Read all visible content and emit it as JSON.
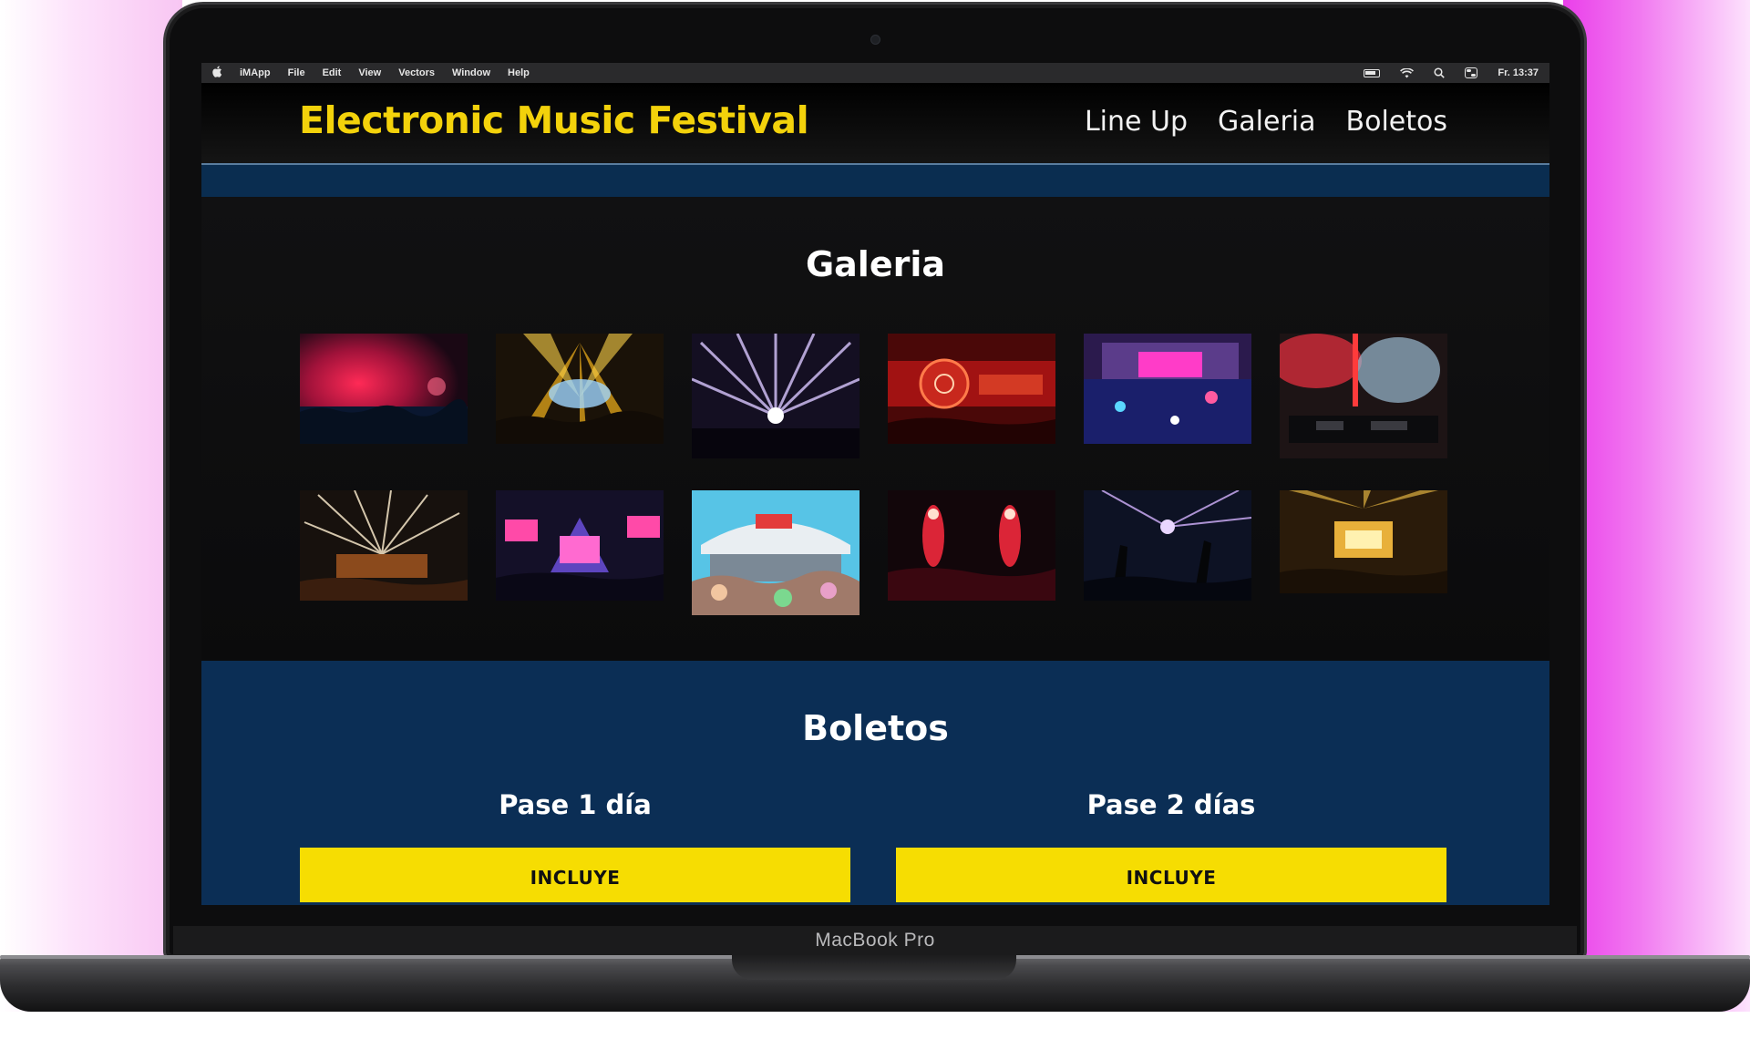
{
  "device": {
    "label": "MacBook Pro"
  },
  "menubar": {
    "app": "iMApp",
    "items": [
      "File",
      "Edit",
      "View",
      "Vectors",
      "Window",
      "Help"
    ],
    "clock": "Fr. 13:37",
    "icons": [
      "apple-icon",
      "battery-icon",
      "wifi-icon",
      "search-icon",
      "control-center-icon"
    ]
  },
  "site": {
    "title": "Electronic Music Festival",
    "nav": [
      "Line Up",
      "Galeria",
      "Boletos"
    ],
    "title_color": "#f3d20b",
    "band_color": "#0a2d50"
  },
  "gallery": {
    "title": "Galeria",
    "photos": [
      "Concierto con luces rojas",
      "Escenario con focos amarillos",
      "Rayos de luz violeta",
      "Escenario rojo decorado",
      "Vista aérea del festival",
      "Cabina de DJ con humo",
      "Fuegos artificiales sobre escenario",
      "Escenario con pantallas rosas",
      "Escenario al aire libre de día",
      "Bengalas rojas",
      "Manos al aire bajo luces azules",
      "Escenario dorado"
    ]
  },
  "tickets": {
    "title": "Boletos",
    "passes": [
      {
        "name": "Pase 1 día",
        "button": "INCLUYE"
      },
      {
        "name": "Pase 2 días",
        "button": "INCLUYE"
      }
    ],
    "accent": "#f6dd02",
    "background": "#0b2e55"
  }
}
